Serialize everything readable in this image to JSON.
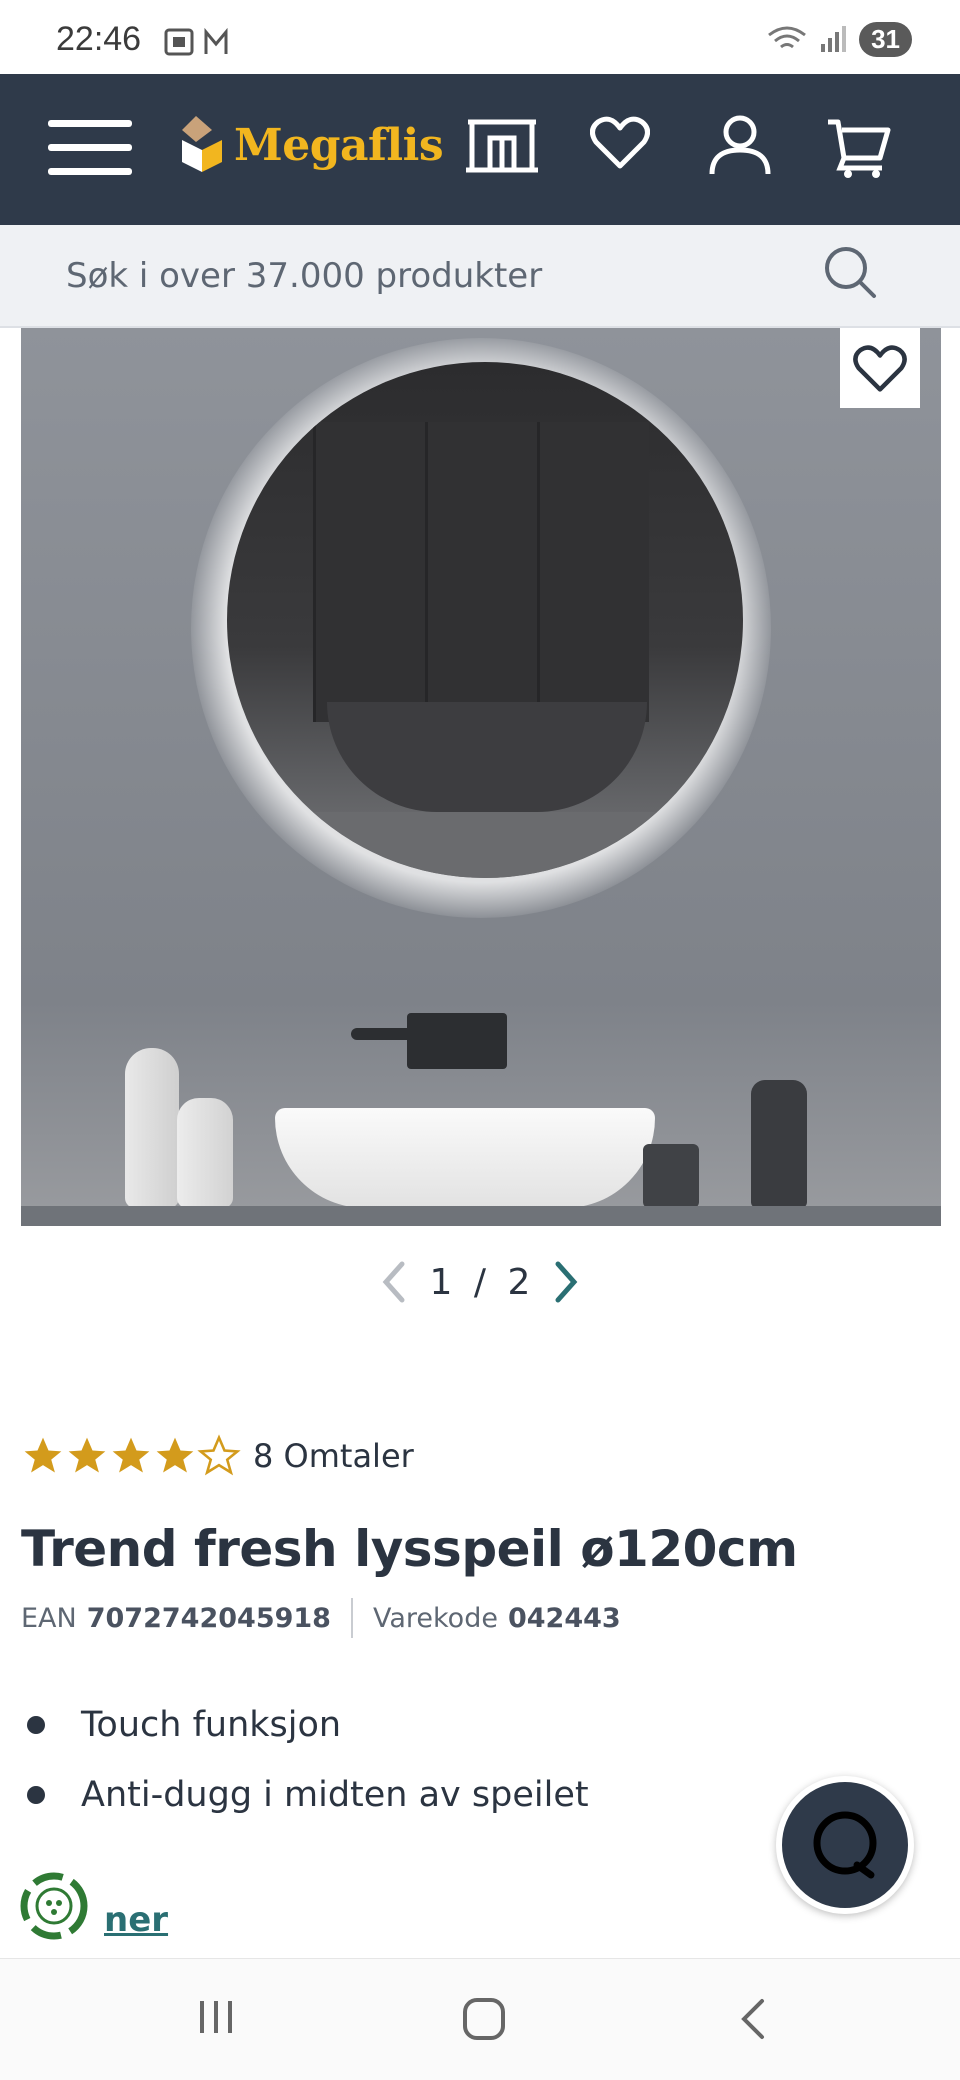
{
  "status_bar": {
    "time": "22:46",
    "battery": "31"
  },
  "header": {
    "brand": "Megaflis",
    "icons": [
      "menu-icon",
      "store-icon",
      "heart-icon",
      "user-icon",
      "cart-icon"
    ]
  },
  "search": {
    "placeholder": "Søk i over 37.000 produkter"
  },
  "gallery": {
    "current": "1",
    "total": "2",
    "separator": "/"
  },
  "product": {
    "rating": 4,
    "rating_max": 5,
    "reviews_label": "8 Omtaler",
    "title": "Trend fresh lysspeil ø120cm",
    "ean_label": "EAN",
    "ean_value": "7072742045918",
    "code_label": "Varekode",
    "code_value": "042443",
    "features": [
      "Touch funksjon",
      "Anti-dugg i midten av speilet"
    ],
    "more_link": "ner"
  },
  "colors": {
    "header_bg": "#2f3a4a",
    "brand": "#f2b61f",
    "star": "#d39b1c",
    "link": "#2a6f73"
  }
}
